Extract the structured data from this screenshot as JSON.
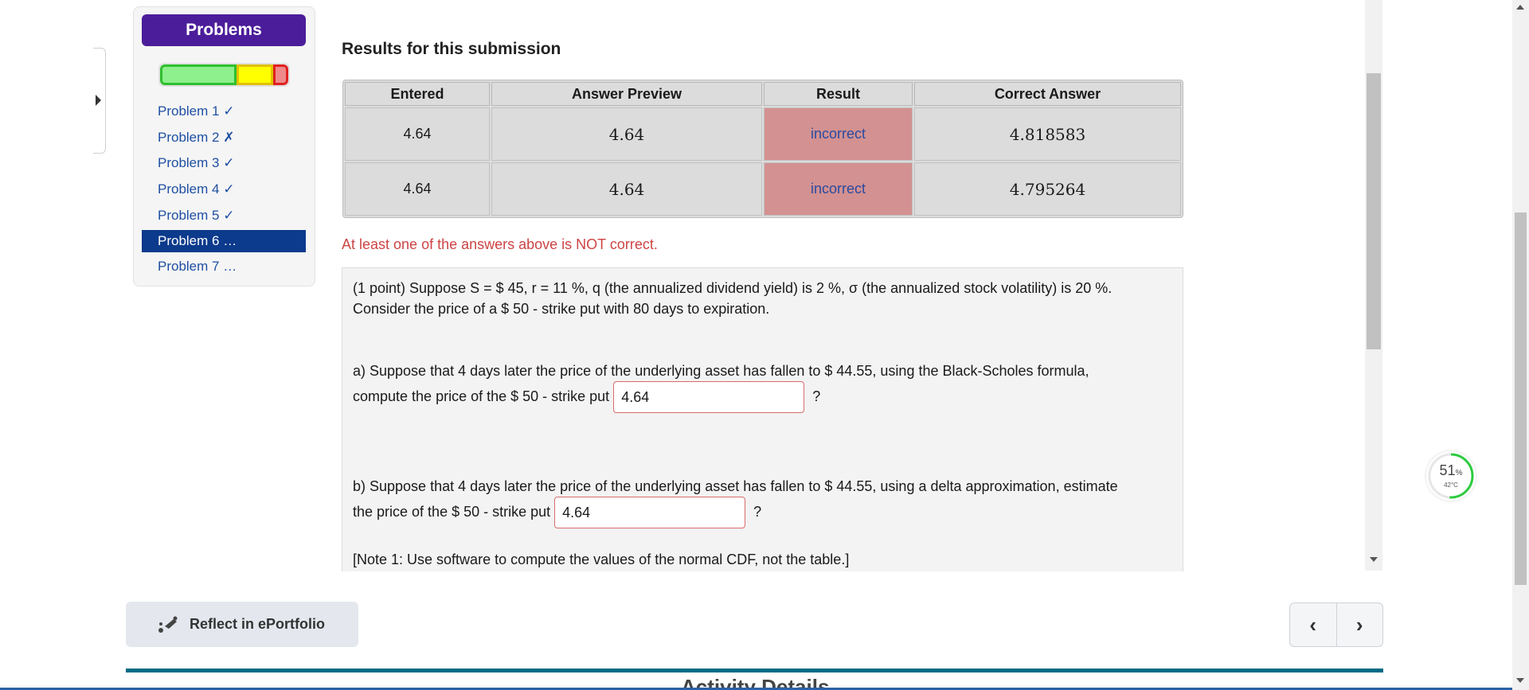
{
  "sidebar": {
    "title": "Problems",
    "items": [
      {
        "label": "Problem 1 ✓"
      },
      {
        "label": "Problem 2 ✗"
      },
      {
        "label": "Problem 3 ✓"
      },
      {
        "label": "Problem 4 ✓"
      },
      {
        "label": "Problem 5 ✓"
      },
      {
        "label": "Problem 6 …"
      },
      {
        "label": "Problem 7 …"
      }
    ],
    "active_index": 5
  },
  "results": {
    "title": "Results for this submission",
    "headers": [
      "Entered",
      "Answer Preview",
      "Result",
      "Correct Answer"
    ],
    "rows": [
      {
        "entered": "4.64",
        "preview": "4.64",
        "result": "incorrect",
        "correct": "4.818583"
      },
      {
        "entered": "4.64",
        "preview": "4.64",
        "result": "incorrect",
        "correct": "4.795264"
      }
    ],
    "warning": "At least one of the answers above is NOT correct."
  },
  "problem": {
    "intro_line1": "(1 point) Suppose S = $ 45, r = 11 %, q (the annualized dividend yield) is 2 %, σ (the annualized stock volatility) is 20 %.",
    "intro_line2": "Consider the price of a $ 50 - strike put with 80 days to expiration.",
    "part_a_line1": "a) Suppose that 4 days later the price of the underlying asset has fallen to $ 44.55, using the Black-Scholes formula,",
    "part_a_line2": "compute the price of the $ 50 - strike put",
    "part_a_value": "4.64",
    "part_b_line1": "b) Suppose that 4 days later the price of the underlying asset has fallen to $ 44.55, using a delta approximation, estimate",
    "part_b_line2": "the price of the $ 50 - strike put",
    "part_b_value": "4.64",
    "question_mark": "?",
    "note": "[Note 1: Use software to compute the values of the normal CDF, not the table.]"
  },
  "footer": {
    "reflect_label": "Reflect in ePortfolio",
    "prev_icon": "‹",
    "next_icon": "›",
    "activity_peek": "Activity Details"
  },
  "widget": {
    "percent": "51",
    "percent_unit": "%",
    "temp": "42°C",
    "gauge_fraction": 0.51
  },
  "colors": {
    "problems_button": "#4b1d9a",
    "active_item": "#0c3a8c",
    "incorrect_cell": "#d39191",
    "warning_text": "#cc4444",
    "teal_bar": "#006b85"
  }
}
